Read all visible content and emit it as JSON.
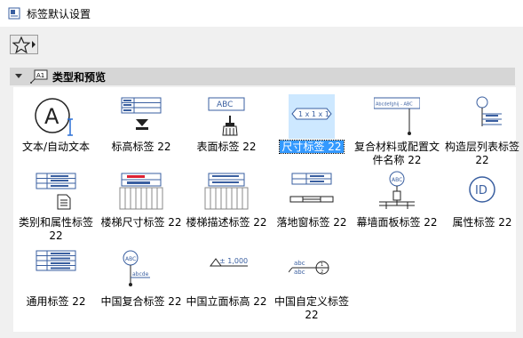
{
  "window": {
    "title": "标签默认设置"
  },
  "toolbar": {
    "favorites_icon": "star-icon"
  },
  "section": {
    "title": "类型和预览"
  },
  "tiles": [
    {
      "label": "文本/自动文本",
      "icon": "text-autotext-icon"
    },
    {
      "label": "标高标签 22",
      "icon": "elevation-label-icon"
    },
    {
      "label": "表面标签 22",
      "icon": "surface-label-icon",
      "thumb_text": "ABC"
    },
    {
      "label": "尺寸标签 22",
      "icon": "dimension-label-icon",
      "selected": true,
      "thumb_text": "1 x 1 x 1"
    },
    {
      "label": "复合材料或配置文件名称 22",
      "icon": "composite-name-icon",
      "thumb_text": "Abcdefghij - ABC"
    },
    {
      "label": "构造层列表标签 22",
      "icon": "layer-list-label-icon"
    },
    {
      "label": "类别和属性标签 22",
      "icon": "category-property-label-icon"
    },
    {
      "label": "楼梯尺寸标签 22",
      "icon": "stair-dimension-label-icon"
    },
    {
      "label": "楼梯描述标签 22",
      "icon": "stair-description-label-icon"
    },
    {
      "label": "落地窗标签 22",
      "icon": "door-window-label-icon"
    },
    {
      "label": "幕墙面板标签 22",
      "icon": "curtain-wall-panel-label-icon",
      "thumb_text": "ABC"
    },
    {
      "label": "属性标签 22",
      "icon": "property-label-icon",
      "thumb_text": "ID"
    },
    {
      "label": "通用标签 22",
      "icon": "general-label-icon"
    },
    {
      "label": "中国复合标签 22",
      "icon": "china-composite-label-icon",
      "thumb_text": "ABC"
    },
    {
      "label": "中国立面标高 22",
      "icon": "china-elevation-icon",
      "thumb_text": "± 1,000"
    },
    {
      "label": "中国自定义标签 22",
      "icon": "china-custom-label-icon",
      "thumb_text": "abc"
    }
  ]
}
